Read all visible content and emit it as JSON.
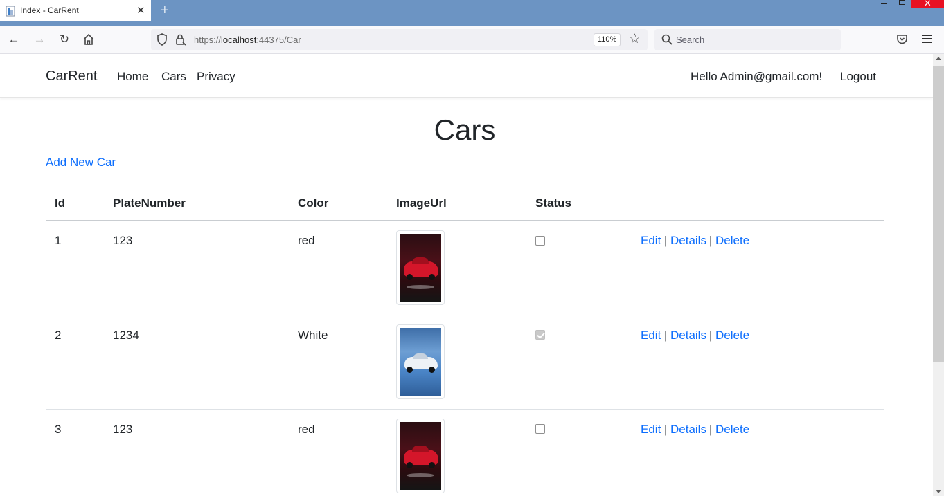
{
  "browser": {
    "tab_title": "Index - CarRent",
    "url_prefix": "https://",
    "url_host": "localhost",
    "url_rest": ":44375/Car",
    "zoom": "110%",
    "search_placeholder": "Search"
  },
  "header": {
    "brand": "CarRent",
    "nav": [
      "Home",
      "Cars",
      "Privacy"
    ],
    "greeting": "Hello Admin@gmail.com!",
    "logout": "Logout"
  },
  "main": {
    "title": "Cars",
    "add_link": "Add New Car",
    "columns": [
      "Id",
      "PlateNumber",
      "Color",
      "ImageUrl",
      "Status"
    ],
    "rows": [
      {
        "id": "1",
        "plate": "123",
        "color": "red",
        "image": "red-car",
        "status": false
      },
      {
        "id": "2",
        "plate": "1234",
        "color": "White",
        "image": "white-car",
        "status": true
      },
      {
        "id": "3",
        "plate": "123",
        "color": "red",
        "image": "red-car",
        "status": false
      }
    ],
    "actions": {
      "edit": "Edit",
      "details": "Details",
      "delete": "Delete",
      "separator": "|"
    }
  },
  "colors": {
    "link": "#0d6efd",
    "text": "#212529",
    "titlebar": "#6c94c3"
  }
}
